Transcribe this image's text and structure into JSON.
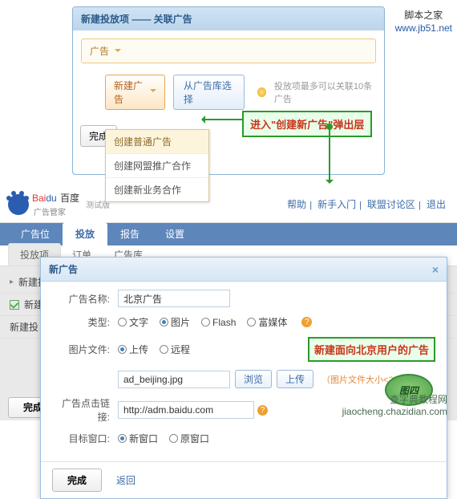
{
  "watermark": {
    "line1": "脚本之家",
    "line2": "www.jb51.net"
  },
  "top": {
    "title": "新建投放项  ——  关联广告",
    "field_label": "广告",
    "new_ad": "新建广告",
    "from_lib": "从广告库选择",
    "tip": "投放项最多可以关联10条广告",
    "done": "完成",
    "dd": [
      "创建普通广告",
      "创建网盟推广合作",
      "创建新业务合作"
    ]
  },
  "callout1": "进入\"创建新广告\"弹出层",
  "baidu": {
    "beta": "测试版",
    "brand": "百度",
    "sub": "广告管家",
    "links": [
      "帮助",
      "新手入门",
      "联盟讨论区",
      "退出"
    ],
    "nav": [
      "广告位",
      "投放",
      "报告",
      "设置"
    ],
    "subnav": [
      "投放项",
      "订单",
      "广告库"
    ],
    "rows": [
      "新建投",
      "新建",
      "新建投"
    ],
    "done": "完成"
  },
  "dlg": {
    "title": "新广告",
    "name_label": "广告名称:",
    "name_value": "北京广告",
    "type_label": "类型:",
    "types": [
      "文字",
      "图片",
      "Flash",
      "富媒体"
    ],
    "file_label": "图片文件:",
    "file_opts": [
      "上传",
      "远程"
    ],
    "file_value": "ad_beijing.jpg",
    "browse": "浏览",
    "upload": "上传",
    "file_hint": "（图片文件大小<256K）",
    "url_label": "广告点击链接:",
    "url_value": "http://adm.baidu.com",
    "target_label": "目标窗口:",
    "targets": [
      "新窗口",
      "原窗口"
    ],
    "done": "完成",
    "back": "返回"
  },
  "callout2": "新建面向北京用户的广告",
  "footer": {
    "line1": "查字典教程网",
    "line2": "jiaocheng.chazidian.com",
    "badge": "图四"
  }
}
